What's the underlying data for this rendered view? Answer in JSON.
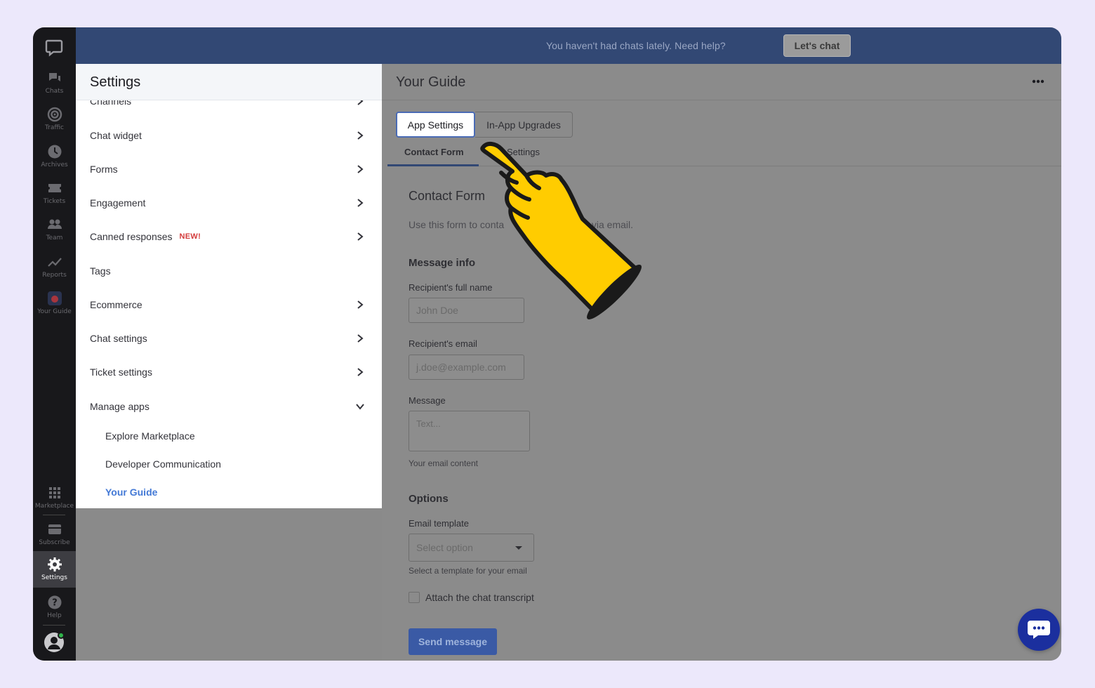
{
  "rail": {
    "items": [
      {
        "label": "Chats",
        "icon": "chats-icon"
      },
      {
        "label": "Traffic",
        "icon": "traffic-icon"
      },
      {
        "label": "Archives",
        "icon": "archives-icon"
      },
      {
        "label": "Tickets",
        "icon": "tickets-icon"
      },
      {
        "label": "Team",
        "icon": "team-icon"
      },
      {
        "label": "Reports",
        "icon": "reports-icon"
      },
      {
        "label": "Your Guide",
        "icon": "your-guide-icon"
      }
    ],
    "bottom_items": [
      {
        "label": "Marketplace",
        "icon": "grid-icon"
      },
      {
        "label": "Subscribe",
        "icon": "card-icon"
      },
      {
        "label": "Settings",
        "icon": "gear-icon"
      },
      {
        "label": "Help",
        "icon": "help-icon"
      }
    ]
  },
  "banner": {
    "text": "You haven't had chats lately. Need help?",
    "button": "Let's chat"
  },
  "settings": {
    "title": "Settings",
    "items": [
      {
        "label": "Channels"
      },
      {
        "label": "Chat widget"
      },
      {
        "label": "Forms"
      },
      {
        "label": "Engagement"
      },
      {
        "label": "Canned responses",
        "badge": "NEW!"
      },
      {
        "label": "Tags"
      },
      {
        "label": "Ecommerce"
      },
      {
        "label": "Chat settings"
      },
      {
        "label": "Ticket settings"
      },
      {
        "label": "Manage apps"
      }
    ],
    "sub_items": [
      {
        "label": "Explore Marketplace"
      },
      {
        "label": "Developer Communication"
      },
      {
        "label": "Your Guide"
      }
    ]
  },
  "main": {
    "title": "Your Guide",
    "tabs": [
      "App Settings",
      "In-App Upgrades"
    ],
    "subtabs": [
      "Contact Form",
      "Settings"
    ],
    "form": {
      "title": "Contact Form",
      "description": "Use this form to conta",
      "description_tail": "s via email.",
      "message_info": "Message info",
      "name_label": "Recipient's full name",
      "name_placeholder": "John Doe",
      "email_label": "Recipient's email",
      "email_placeholder": "j.doe@example.com",
      "message_label": "Message",
      "message_placeholder": "Text...",
      "message_hint": "Your email content",
      "options": "Options",
      "template_label": "Email template",
      "template_placeholder": "Select option",
      "template_hint": "Select a template for your email",
      "attach_label": "Attach the chat transcript",
      "send_button": "Send message"
    }
  },
  "colors": {
    "banner": "#324874",
    "rail": "#18181b",
    "accent": "#4379d6",
    "badge": "#d33b3b",
    "hand": "#ffcc00",
    "chat_fab": "#1b2f9e"
  }
}
